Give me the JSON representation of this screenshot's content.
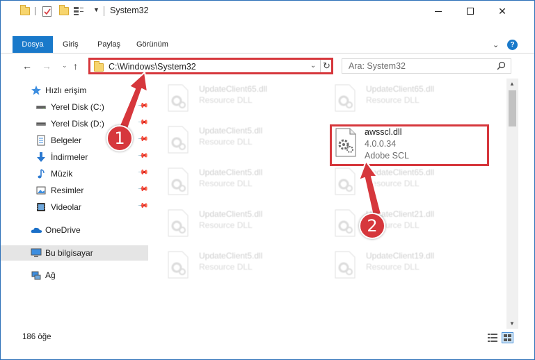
{
  "window": {
    "title": "System32",
    "minimize_label": "–",
    "maximize_label": "□",
    "close_label": "✕"
  },
  "ribbon": {
    "tabs": [
      "Dosya",
      "Giriş",
      "Paylaş",
      "Görünüm"
    ],
    "help_label": "?"
  },
  "address": {
    "path": "C:\\Windows\\System32"
  },
  "search": {
    "placeholder": "Ara: System32"
  },
  "sidebar": {
    "items": [
      {
        "label": "Hızlı erişim",
        "icon": "star-icon",
        "pinned": false
      },
      {
        "label": "Yerel Disk (C:)",
        "icon": "drive-icon",
        "pinned": true
      },
      {
        "label": "Yerel Disk (D:)",
        "icon": "drive-icon",
        "pinned": true
      },
      {
        "label": "Belgeler",
        "icon": "documents-icon",
        "pinned": true
      },
      {
        "label": "İndirmeler",
        "icon": "download-icon",
        "pinned": true
      },
      {
        "label": "Müzik",
        "icon": "music-icon",
        "pinned": true
      },
      {
        "label": "Resimler",
        "icon": "pictures-icon",
        "pinned": true
      },
      {
        "label": "Videolar",
        "icon": "videos-icon",
        "pinned": true
      },
      {
        "label": "OneDrive",
        "icon": "cloud-icon",
        "pinned": false
      },
      {
        "label": "Bu bilgisayar",
        "icon": "computer-icon",
        "pinned": false,
        "selected": true
      },
      {
        "label": "Ağ",
        "icon": "network-icon",
        "pinned": false
      }
    ]
  },
  "files": {
    "left_column": [
      {
        "name": "UpdateClient65.dll",
        "type": "Resource DLL"
      },
      {
        "name": "UpdateClient5.dll",
        "type": "Resource DLL"
      },
      {
        "name": "UpdateClient5.dll",
        "type": "Resource DLL"
      },
      {
        "name": "UpdateClient5.dll",
        "type": "Resource DLL"
      },
      {
        "name": "UpdateClient5.dll",
        "type": "Resource DLL"
      }
    ],
    "right_column": [
      {
        "name": "UpdateClient65.dll",
        "type": "Resource DLL"
      },
      {
        "name": "UpdateClient65.dll",
        "type": "Resource DLL"
      },
      {
        "name": "UpdateClient21.dll",
        "type": "Resource DLL"
      },
      {
        "name": "UpdateClient19.dll",
        "type": "Resource DLL"
      }
    ],
    "highlighted": {
      "name": "awsscl.dll",
      "version": "4.0.0.34",
      "description": "Adobe SCL"
    }
  },
  "status": {
    "item_count": "186 öğe"
  },
  "annotations": {
    "step1": "1",
    "step2": "2",
    "color": "#d6373c"
  }
}
